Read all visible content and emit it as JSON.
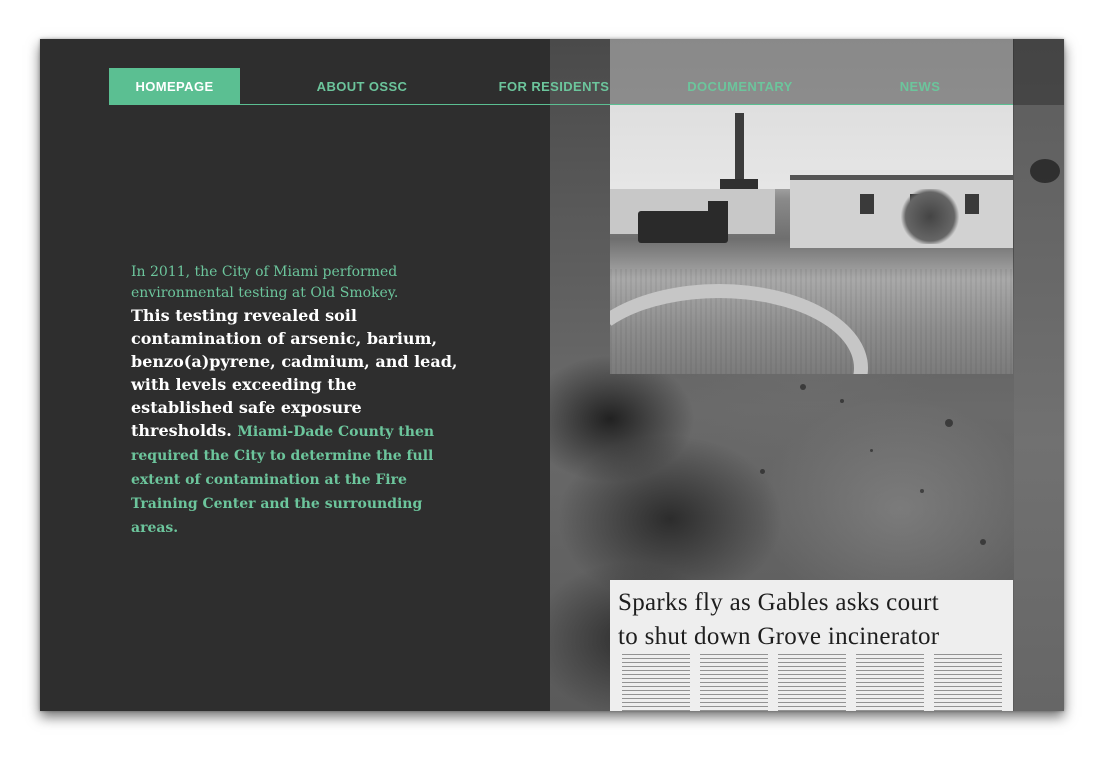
{
  "nav": {
    "items": [
      {
        "label": "HOMEPAGE",
        "active": true
      },
      {
        "label": "ABOUT OSSC",
        "active": false
      },
      {
        "label": "FOR RESIDENTS",
        "active": false
      },
      {
        "label": "DOCUMENTARY",
        "active": false
      },
      {
        "label": "NEWS",
        "active": false
      }
    ],
    "accent_color": "#5bbf92"
  },
  "story": {
    "intro": "In 2011, the City of Miami performed environmental testing at Old Smokey.",
    "emphasis": "This testing revealed soil contamination of arsenic, barium, benzo(a)pyrene, cadmium, and lead, with levels exceeding the established safe exposure thresholds.",
    "outro": "Miami-Dade County then required the City to determine the full extent of contamination at the Fire Training Center and the surrounding areas."
  },
  "newspaper": {
    "headline_line1": "Sparks fly as Gables asks court",
    "headline_line2": "to shut down Grove incinerator"
  },
  "images": {
    "photo": "historic-incinerator-photo",
    "clipping": "newspaper-clipping"
  }
}
